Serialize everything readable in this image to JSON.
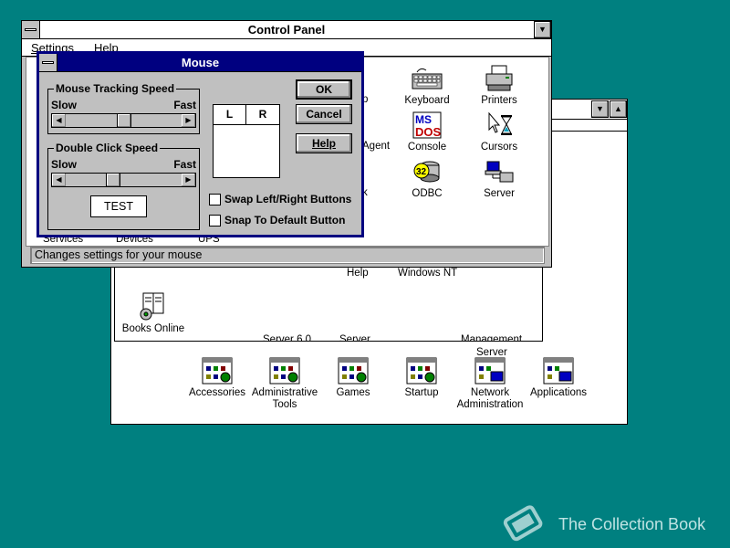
{
  "control_panel": {
    "title": "Control Panel",
    "menu": [
      "Settings",
      "Help"
    ],
    "icons": [
      {
        "label": "Keyboard",
        "icon": "keyboard-icon"
      },
      {
        "label": "Printers",
        "icon": "printer-icon"
      },
      {
        "label": "Console",
        "icon": "ms-dos-console-icon"
      },
      {
        "label": "Cursors",
        "icon": "cursor-icon"
      },
      {
        "label": "ODBC",
        "icon": "odbc-icon"
      },
      {
        "label": "Server",
        "icon": "server-icon"
      }
    ],
    "partial_labels": [
      "p",
      "Agent",
      "k"
    ],
    "bottom_row_labels": [
      "Services",
      "Devices",
      "UPS"
    ],
    "status": "Changes settings for your mouse"
  },
  "mouse_dialog": {
    "title": "Mouse",
    "tracking": {
      "label": "Mouse Tracking Speed",
      "slow": "Slow",
      "fast": "Fast",
      "level": 0.5
    },
    "double_click": {
      "label": "Double Click Speed",
      "slow": "Slow",
      "fast": "Fast",
      "level": 0.4
    },
    "test_label": "TEST",
    "lr_left": "L",
    "lr_right": "R",
    "buttons": {
      "ok": "OK",
      "cancel": "Cancel",
      "help": "Help"
    },
    "swap_label": "Swap Left/Right Buttons",
    "snap_label": "Snap To Default Button"
  },
  "back_window": {
    "visible_labels": [
      "Help",
      "Windows NT"
    ],
    "books_online": "Books Online",
    "clipped_labels": [
      "Server 6.0",
      "Server",
      "Management"
    ]
  },
  "program_manager": {
    "groups": [
      {
        "label": "Accessories"
      },
      {
        "label": "Administrative Tools"
      },
      {
        "label": "Games"
      },
      {
        "label": "Startup"
      },
      {
        "label": "Network Administration"
      },
      {
        "label": "Applications"
      }
    ],
    "server_label": "Server"
  },
  "watermark": "The Collection Book",
  "colors": {
    "desktop": "#008080",
    "title_active": "#000080",
    "button_face": "#c0c0c0"
  }
}
